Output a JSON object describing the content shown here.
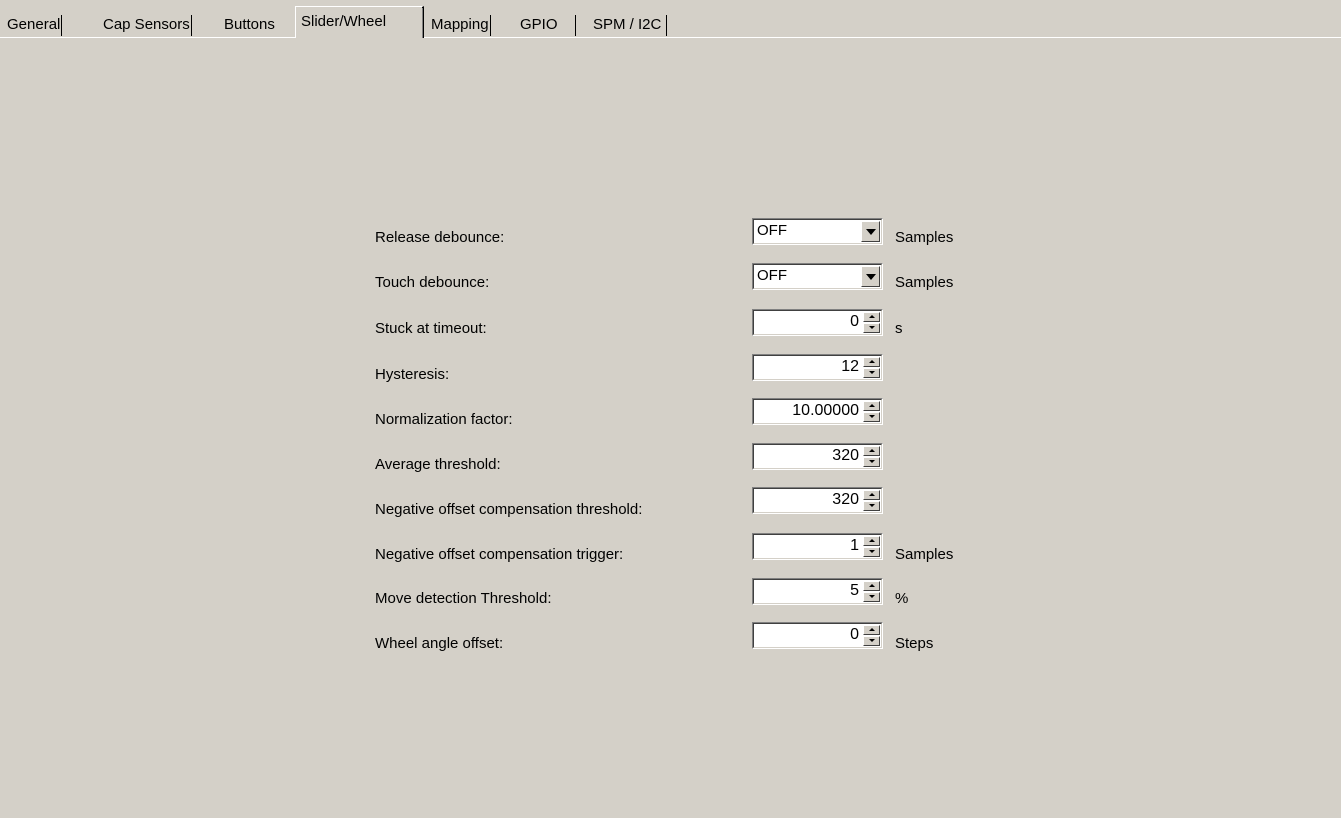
{
  "tabs": [
    {
      "label": "General",
      "active": false
    },
    {
      "label": "Cap Sensors",
      "active": false
    },
    {
      "label": "Buttons",
      "active": false
    },
    {
      "label": "Slider/Wheel",
      "active": true
    },
    {
      "label": "Mapping",
      "active": false
    },
    {
      "label": "GPIO",
      "active": false
    },
    {
      "label": "SPM / I2C",
      "active": false
    }
  ],
  "settings": {
    "release_debounce": {
      "label": "Release debounce:",
      "value": "OFF",
      "unit": "Samples"
    },
    "touch_debounce": {
      "label": "Touch debounce:",
      "value": "OFF",
      "unit": "Samples"
    },
    "stuck_timeout": {
      "label": "Stuck at timeout:",
      "value": "0",
      "unit": "s"
    },
    "hysteresis": {
      "label": "Hysteresis:",
      "value": "12"
    },
    "normalization_factor": {
      "label": "Normalization factor:",
      "value": "10.00000"
    },
    "average_threshold": {
      "label": "Average threshold:",
      "value": "320"
    },
    "neg_offset_threshold": {
      "label": "Negative offset compensation threshold:",
      "value": "320"
    },
    "neg_offset_trigger": {
      "label": "Negative offset compensation trigger:",
      "value": "1",
      "unit": "Samples"
    },
    "move_detection_threshold": {
      "label": "Move detection Threshold:",
      "value": "5",
      "unit": "%"
    },
    "wheel_angle_offset": {
      "label": "Wheel angle offset:",
      "value": "0",
      "unit": "Steps"
    }
  }
}
